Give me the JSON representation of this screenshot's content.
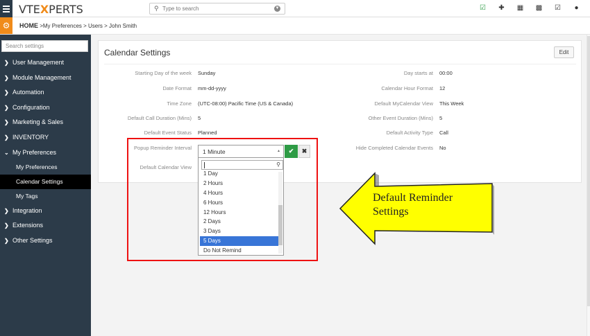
{
  "app": {
    "logo_left": "VTE",
    "logo_x": "X",
    "logo_right": "PERTS"
  },
  "search": {
    "placeholder": "Type to search"
  },
  "breadcrumb": {
    "home": "HOME",
    "path": " >My Preferences > Users > John Smith"
  },
  "sidebar": {
    "search_placeholder": "Search settings",
    "items": [
      {
        "label": "User Management"
      },
      {
        "label": "Module Management"
      },
      {
        "label": "Automation"
      },
      {
        "label": "Configuration"
      },
      {
        "label": "Marketing & Sales"
      },
      {
        "label": "INVENTORY"
      },
      {
        "label": "My Preferences"
      }
    ],
    "subitems": [
      {
        "label": "My Preferences"
      },
      {
        "label": "Calendar Settings"
      },
      {
        "label": "My Tags"
      }
    ],
    "items_after": [
      {
        "label": "Integration"
      },
      {
        "label": "Extensions"
      },
      {
        "label": "Other Settings"
      }
    ]
  },
  "card": {
    "title": "Calendar Settings",
    "edit_label": "Edit",
    "left_fields": [
      {
        "label": "Starting Day of the week",
        "value": "Sunday"
      },
      {
        "label": "Date Format",
        "value": "mm-dd-yyyy"
      },
      {
        "label": "Time Zone",
        "value": "(UTC-08:00) Pacific Time (US & Canada)"
      },
      {
        "label": "Default Call Duration (Mins)",
        "value": "5"
      },
      {
        "label": "Default Event Status",
        "value": "Planned"
      },
      {
        "label": "Popup Reminder Interval",
        "value": ""
      },
      {
        "label": "Default Calendar View",
        "value": ""
      }
    ],
    "right_fields": [
      {
        "label": "Day starts at",
        "value": "00:00"
      },
      {
        "label": "Calendar Hour Format",
        "value": "12"
      },
      {
        "label": "Default MyCalendar View",
        "value": "This Week"
      },
      {
        "label": "Other Event Duration (Mins)",
        "value": "5"
      },
      {
        "label": "Default Activity Type",
        "value": "Call"
      },
      {
        "label": "Hide Completed Calendar Events",
        "value": "No"
      }
    ]
  },
  "dropdown": {
    "selected": "1 Minute",
    "options": [
      "1 Day",
      "2 Hours",
      "4 Hours",
      "6 Hours",
      "12 Hours",
      "2 Days",
      "3 Days",
      "5 Days",
      "Do Not Remind"
    ],
    "highlighted": "5 Days"
  },
  "callout": {
    "line1": "Default Reminder",
    "line2": "Settings"
  },
  "colors": {
    "sidebar": "#2c3b49",
    "accent": "#f08b1a",
    "highlight": "#3875d7",
    "confirm": "#2e9b45",
    "annotation_box": "#ee1111",
    "arrow": "#ffff00"
  },
  "icons": [
    "menu-icon",
    "search-icon",
    "dropdown-icon",
    "calendar-check-icon",
    "plus-circle-icon",
    "calendar-icon",
    "chart-icon",
    "checkbox-icon",
    "user-icon",
    "gear-icon"
  ]
}
